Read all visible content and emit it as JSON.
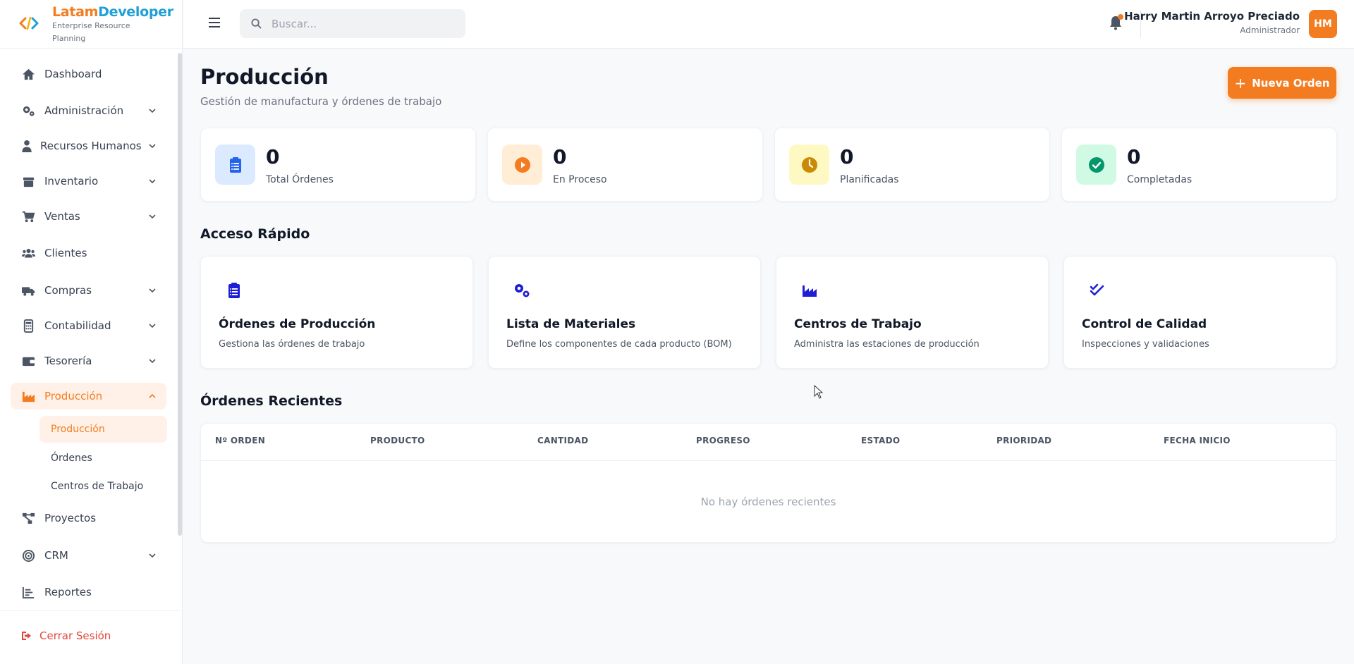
{
  "brand": {
    "name_part1": "Latam",
    "name_part2": "Developer",
    "subtitle": "Enterprise Resource Planning",
    "colors": {
      "orange": "#f47c20",
      "blue": "#1ea0d6"
    }
  },
  "sidebar": {
    "items": [
      {
        "label": "Dashboard",
        "icon": "home-icon"
      },
      {
        "label": "Administración",
        "icon": "cogs-icon"
      },
      {
        "label": "Recursos Humanos",
        "icon": "user-tie-icon"
      },
      {
        "label": "Inventario",
        "icon": "box-icon"
      },
      {
        "label": "Ventas",
        "icon": "cart-icon"
      },
      {
        "label": "Clientes",
        "icon": "users-icon"
      },
      {
        "label": "Compras",
        "icon": "truck-icon"
      },
      {
        "label": "Contabilidad",
        "icon": "calculator-icon"
      },
      {
        "label": "Tesorería",
        "icon": "wallet-icon"
      },
      {
        "label": "Producción",
        "icon": "industry-icon",
        "active": true
      },
      {
        "label": "Proyectos",
        "icon": "project-diagram-icon"
      },
      {
        "label": "CRM",
        "icon": "bullseye-icon"
      },
      {
        "label": "Reportes",
        "icon": "chart-bar-icon"
      }
    ],
    "sub_items": [
      {
        "label": "Producción",
        "active": true
      },
      {
        "label": "Órdenes"
      },
      {
        "label": "Centros de Trabajo"
      }
    ],
    "logout_label": "Cerrar Sesión"
  },
  "topbar": {
    "search_placeholder": "Buscar...",
    "user_name": "Harry Martin Arroyo Preciado",
    "user_role": "Administrador",
    "avatar_initials": "HM"
  },
  "page": {
    "title": "Producción",
    "subtitle": "Gestión de manufactura y órdenes de trabajo",
    "new_button_label": "Nueva Orden"
  },
  "stats": [
    {
      "value": "0",
      "label": "Total Órdenes",
      "icon": "clipboard-list-icon",
      "color": "#2563eb",
      "bg": "#dbeafe"
    },
    {
      "value": "0",
      "label": "En Proceso",
      "icon": "play-circle-icon",
      "color": "#f47c20",
      "bg": "#ffedd5"
    },
    {
      "value": "0",
      "label": "Planificadas",
      "icon": "clock-icon",
      "color": "#ca8a04",
      "bg": "#fef9c3"
    },
    {
      "value": "0",
      "label": "Completadas",
      "icon": "check-circle-icon",
      "color": "#059669",
      "bg": "#d1fae5"
    }
  ],
  "quick_access": {
    "title": "Acceso Rápido",
    "cards": [
      {
        "title": "Órdenes de Producción",
        "description": "Gestiona las órdenes de trabajo",
        "icon": "clipboard-list-icon"
      },
      {
        "title": "Lista de Materiales",
        "description": "Define los componentes de cada producto (BOM)",
        "icon": "cogs-icon"
      },
      {
        "title": "Centros de Trabajo",
        "description": "Administra las estaciones de producción",
        "icon": "industry-icon"
      },
      {
        "title": "Control de Calidad",
        "description": "Inspecciones y validaciones",
        "icon": "check-double-icon"
      }
    ]
  },
  "recent_orders": {
    "title": "Órdenes Recientes",
    "columns": [
      "Nº ORDEN",
      "PRODUCTO",
      "CANTIDAD",
      "PROGRESO",
      "ESTADO",
      "PRIORIDAD",
      "FECHA INICIO"
    ],
    "rows": [],
    "empty_message": "No hay órdenes recientes"
  }
}
